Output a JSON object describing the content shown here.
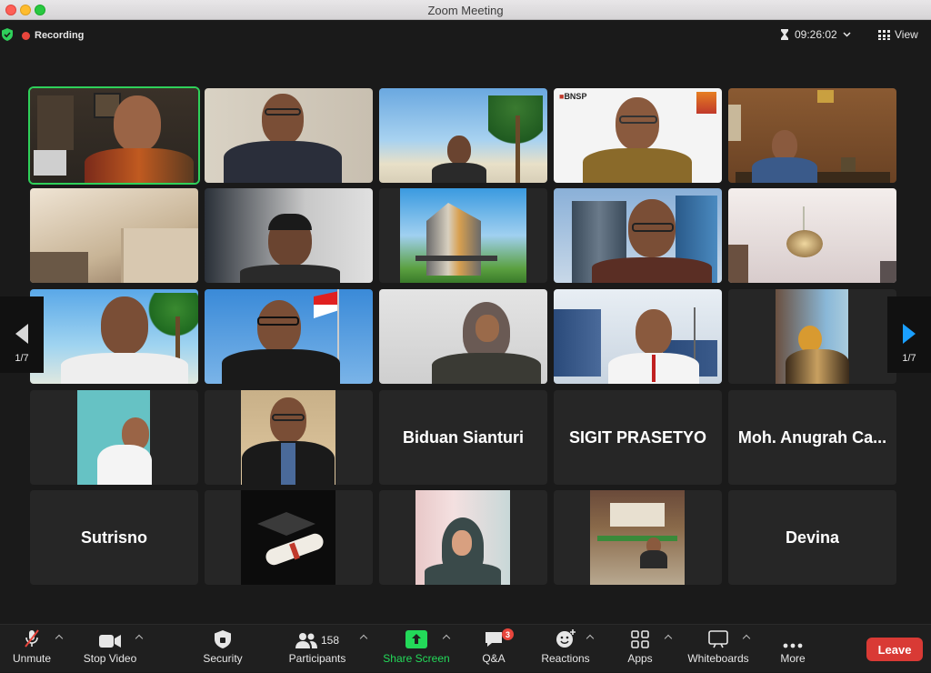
{
  "window": {
    "title": "Zoom Meeting"
  },
  "topbar": {
    "recording_label": "Recording",
    "time": "09:26:02",
    "view_label": "View"
  },
  "pager": {
    "left_page": "1/7",
    "right_page": "1/7"
  },
  "name_tiles": {
    "biduan": "Biduan Sianturi",
    "sigit": "SIGIT PRASETYO",
    "anugrah": "Moh. Anugrah Ca...",
    "sutrisno": "Sutrisno",
    "devina": "Devina"
  },
  "logo": {
    "bnsp": "BNSP"
  },
  "toolbar": {
    "unmute": "Unmute",
    "stop_video": "Stop Video",
    "security": "Security",
    "participants": "Participants",
    "participants_count": "158",
    "share_screen": "Share Screen",
    "qa": "Q&A",
    "qa_badge": "3",
    "reactions": "Reactions",
    "apps": "Apps",
    "whiteboards": "Whiteboards",
    "more": "More",
    "leave": "Leave"
  },
  "colors": {
    "accent_green": "#2fd05a",
    "share_green": "#23d959",
    "leave_red": "#d93a35",
    "nav_blue": "#1a9fff"
  }
}
